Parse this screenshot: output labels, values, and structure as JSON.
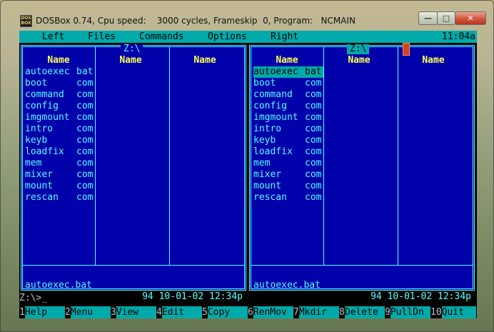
{
  "window": {
    "title": "DOSBox 0.74, Cpu speed:    3000 cycles, Frameskip  0, Program:   NCMAIN",
    "icon_text": "DOS BOX",
    "controls": [
      "minimize",
      "maximize",
      "close"
    ]
  },
  "menu": {
    "items": [
      "Left",
      "Files",
      "Commands",
      "Options",
      "Right"
    ],
    "clock": "11:04a"
  },
  "left_panel": {
    "path": "Z:\\",
    "columns": [
      "Name",
      "Name",
      "Name"
    ],
    "files": [
      {
        "name": "autoexec",
        "ext": "bat"
      },
      {
        "name": "boot",
        "ext": "com"
      },
      {
        "name": "command",
        "ext": "com"
      },
      {
        "name": "config",
        "ext": "com"
      },
      {
        "name": "imgmount",
        "ext": "com"
      },
      {
        "name": "intro",
        "ext": "com"
      },
      {
        "name": "keyb",
        "ext": "com"
      },
      {
        "name": "loadfix",
        "ext": "com"
      },
      {
        "name": "mem",
        "ext": "com"
      },
      {
        "name": "mixer",
        "ext": "com"
      },
      {
        "name": "mount",
        "ext": "com"
      },
      {
        "name": "rescan",
        "ext": "com"
      }
    ],
    "status_name": "autoexec.bat",
    "status_info": "94 10-01-02 12:34p"
  },
  "right_panel": {
    "path": "Z:\\",
    "columns": [
      "Name",
      "Name",
      "Name"
    ],
    "selected_index": 0,
    "files": [
      {
        "name": "autoexec",
        "ext": "bat"
      },
      {
        "name": "boot",
        "ext": "com"
      },
      {
        "name": "command",
        "ext": "com"
      },
      {
        "name": "config",
        "ext": "com"
      },
      {
        "name": "imgmount",
        "ext": "com"
      },
      {
        "name": "intro",
        "ext": "com"
      },
      {
        "name": "keyb",
        "ext": "com"
      },
      {
        "name": "loadfix",
        "ext": "com"
      },
      {
        "name": "mem",
        "ext": "com"
      },
      {
        "name": "mixer",
        "ext": "com"
      },
      {
        "name": "mount",
        "ext": "com"
      },
      {
        "name": "rescan",
        "ext": "com"
      }
    ],
    "status_name": "autoexec.bat",
    "status_info": "94 10-01-02 12:34p"
  },
  "prompt": "Z:\\>_",
  "function_keys": [
    {
      "num": "1",
      "label": "Help"
    },
    {
      "num": "2",
      "label": "Menu"
    },
    {
      "num": "3",
      "label": "View"
    },
    {
      "num": "4",
      "label": "Edit"
    },
    {
      "num": "5",
      "label": "Copy"
    },
    {
      "num": "6",
      "label": "RenMov"
    },
    {
      "num": "7",
      "label": "Mkdir"
    },
    {
      "num": "8",
      "label": "Delete"
    },
    {
      "num": "9",
      "label": "PullDn"
    },
    {
      "num": "10",
      "label": "Quit"
    }
  ],
  "colors": {
    "panel_bg": "#0000aa",
    "cyan_text": "#55ffff",
    "header_yellow": "#ffff55",
    "bar_cyan": "#00aaaa"
  }
}
